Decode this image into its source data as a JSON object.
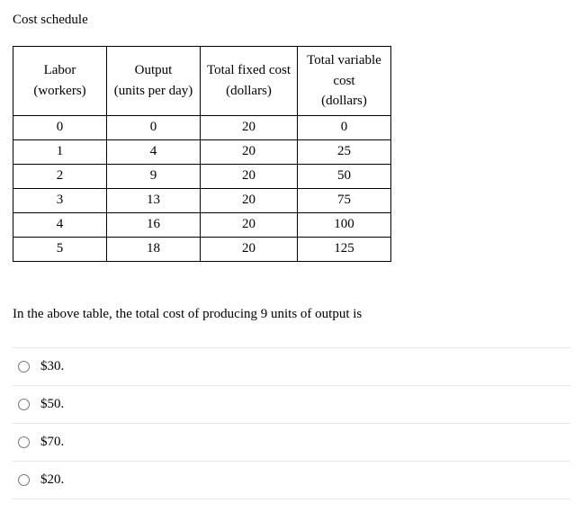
{
  "title": "Cost schedule",
  "table": {
    "headers": {
      "labor": "Labor (workers)",
      "output_line1": "Output",
      "output_line2": "(units per day)",
      "fixed_line1": "Total fixed cost",
      "fixed_line2": "(dollars)",
      "variable_line1": "Total variable",
      "variable_line2": "cost",
      "variable_line3": "(dollars)"
    },
    "rows": [
      {
        "labor": "0",
        "output": "0",
        "fixed": "20",
        "variable": "0"
      },
      {
        "labor": "1",
        "output": "4",
        "fixed": "20",
        "variable": "25"
      },
      {
        "labor": "2",
        "output": "9",
        "fixed": "20",
        "variable": "50"
      },
      {
        "labor": "3",
        "output": "13",
        "fixed": "20",
        "variable": "75"
      },
      {
        "labor": "4",
        "output": "16",
        "fixed": "20",
        "variable": "100"
      },
      {
        "labor": "5",
        "output": "18",
        "fixed": "20",
        "variable": "125"
      }
    ]
  },
  "question": "In the above table, the total cost of producing 9 units of output is",
  "options": [
    {
      "label": "$30."
    },
    {
      "label": "$50."
    },
    {
      "label": "$70."
    },
    {
      "label": "$20."
    }
  ]
}
